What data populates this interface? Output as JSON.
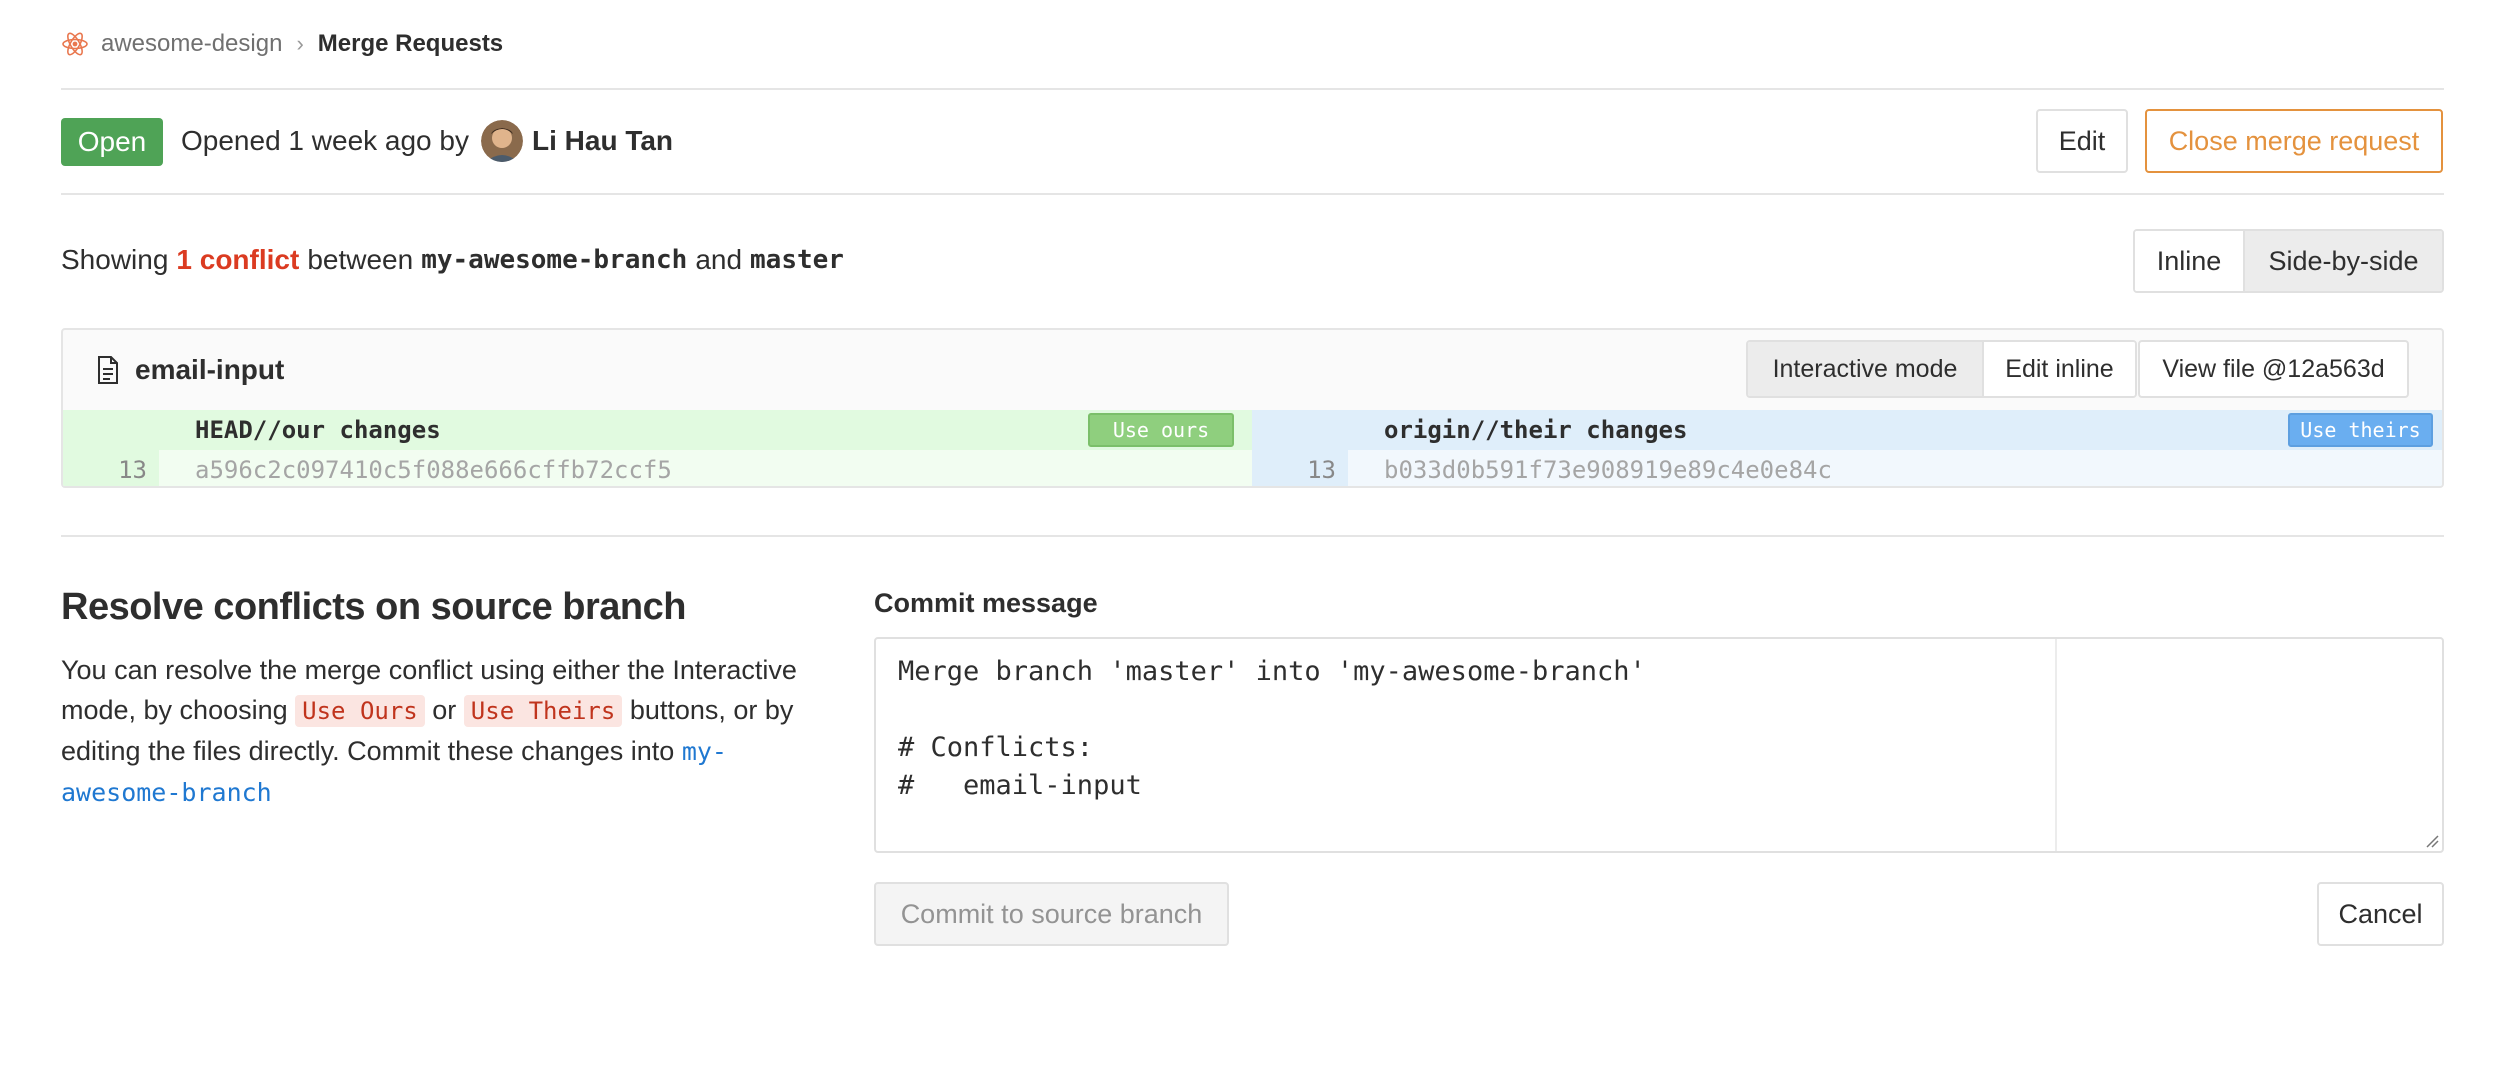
{
  "breadcrumb": {
    "project": "awesome-design",
    "separator": "›",
    "current": "Merge Requests"
  },
  "merge_request": {
    "status": "Open",
    "opened_text": "Opened 1 week ago by",
    "author": "Li Hau Tan",
    "edit_label": "Edit",
    "close_label": "Close merge request"
  },
  "conflicts": {
    "showing_prefix": "Showing",
    "conflict_count": "1 conflict",
    "between_text": "between",
    "source_branch": "my-awesome-branch",
    "and_text": "and",
    "target_branch": "master",
    "view_modes": [
      "Inline",
      "Side-by-side"
    ],
    "active_view": "Side-by-side"
  },
  "file": {
    "name": "email-input",
    "modes": [
      "Interactive mode",
      "Edit inline"
    ],
    "active_mode": "Interactive mode",
    "view_file_label": "View file @12a563d",
    "ours": {
      "header": "HEAD//our changes",
      "button": "Use ours",
      "line_number": "13",
      "content": "a596c2c097410c5f088e666cffb72ccf5"
    },
    "theirs": {
      "header": "origin//their changes",
      "button": "Use theirs",
      "line_number": "13",
      "content": "b033d0b591f73e908919e89c4e0e84c"
    }
  },
  "resolve": {
    "title": "Resolve conflicts on source branch",
    "text_1": "You can resolve the merge conflict using either the Interactive mode, by choosing",
    "chip_ours": "Use Ours",
    "or_text": "or",
    "chip_theirs": "Use Theirs",
    "text_2": "buttons, or by editing the files directly. Commit these changes into",
    "branch_link": "my-awesome-branch"
  },
  "commit": {
    "label": "Commit message",
    "message": "Merge branch 'master' into 'my-awesome-branch'\n\n# Conflicts:\n#   email-input",
    "commit_button": "Commit to source branch",
    "cancel_button": "Cancel"
  },
  "colors": {
    "open_badge": "#4fa356",
    "close_button": "#e4923e",
    "conflict_text": "#db3b21",
    "ours_header_bg": "#e1fae0",
    "theirs_header_bg": "#dfeefa",
    "link": "#1f78d1"
  },
  "icons": {
    "project_logo": "atom-logo-icon",
    "avatar": "user-avatar",
    "file": "file-icon",
    "resize": "resize-handle-icon"
  }
}
